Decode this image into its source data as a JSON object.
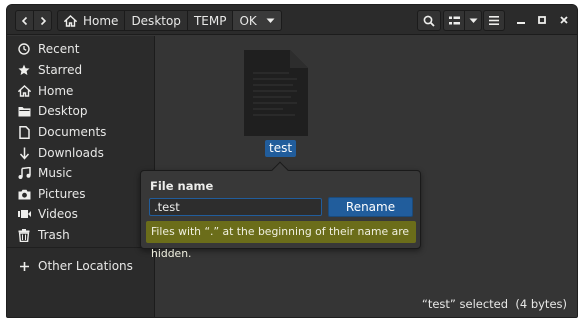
{
  "header": {
    "back_icon": "chevron-left-icon",
    "forward_icon": "chevron-right-icon",
    "breadcrumbs": [
      "Home",
      "Desktop",
      "TEMP",
      "OK"
    ],
    "home_icon": "home-icon",
    "search_icon": "search-icon",
    "view_icon": "list-view-icon",
    "view_dropdown_icon": "chevron-down-icon",
    "menu_icon": "hamburger-menu-icon",
    "minimize_icon": "minimize-icon",
    "maximize_icon": "maximize-icon",
    "close_icon": "close-icon"
  },
  "sidebar": {
    "items": [
      {
        "label": "Recent",
        "icon": "clock-icon"
      },
      {
        "label": "Starred",
        "icon": "star-icon"
      },
      {
        "label": "Home",
        "icon": "home-icon"
      },
      {
        "label": "Desktop",
        "icon": "folder-icon"
      },
      {
        "label": "Documents",
        "icon": "document-icon"
      },
      {
        "label": "Downloads",
        "icon": "download-icon"
      },
      {
        "label": "Music",
        "icon": "music-icon"
      },
      {
        "label": "Pictures",
        "icon": "camera-icon"
      },
      {
        "label": "Videos",
        "icon": "video-icon"
      },
      {
        "label": "Trash",
        "icon": "trash-icon"
      }
    ],
    "other_locations": {
      "label": "Other Locations",
      "icon": "plus-icon"
    }
  },
  "content": {
    "file": {
      "name": "test",
      "icon": "text-file-icon"
    }
  },
  "rename_popover": {
    "title": "File name",
    "input_value": ".test",
    "button_label": "Rename",
    "warning": "Files with “.” at the beginning of their name are hidden."
  },
  "status": {
    "text": "“test” selected  (4 bytes)"
  },
  "colors": {
    "accent": "#215d9c",
    "warning_bg": "#6b6d1a",
    "window_bg": "#353535",
    "sidebar_bg": "#2b2b2b"
  }
}
